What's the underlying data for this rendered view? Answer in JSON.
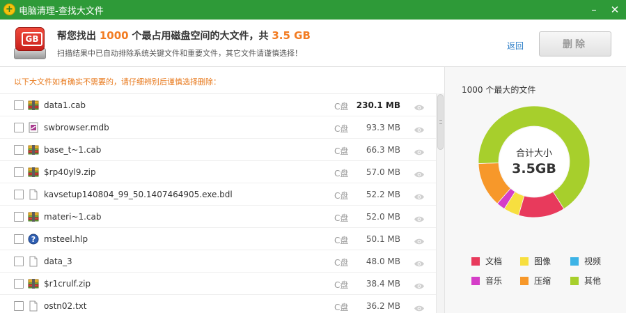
{
  "titlebar": {
    "title": "电脑清理-查找大文件",
    "minimize_glyph": "–",
    "close_glyph": "✕"
  },
  "header": {
    "headline_pre": "帮您找出 ",
    "file_count": "1000",
    "headline_mid": " 个最占用磁盘空间的大文件，共 ",
    "total_size": "3.5 GB",
    "subline": "扫描结果中已自动排除系统关键文件和重要文件，其它文件请谨慎选择！",
    "icon_text": "GB",
    "back_label": "返回",
    "delete_label": "删除"
  },
  "notice": "以下大文件如有确实不需要的，请仔细辨别后谨慎选择删除：",
  "files": [
    {
      "name": "data1.cab",
      "drive": "C盘",
      "size": "230.1 MB",
      "icon": "archive-icon"
    },
    {
      "name": "swbrowser.mdb",
      "drive": "C盘",
      "size": "93.3 MB",
      "icon": "database-file-icon"
    },
    {
      "name": "base_t~1.cab",
      "drive": "C盘",
      "size": "66.3 MB",
      "icon": "archive-icon"
    },
    {
      "name": "$rp40yl9.zip",
      "drive": "C盘",
      "size": "57.0 MB",
      "icon": "archive-icon"
    },
    {
      "name": "kavsetup140804_99_50.1407464905.exe.bdl",
      "drive": "C盘",
      "size": "52.2 MB",
      "icon": "blank-file-icon"
    },
    {
      "name": "materi~1.cab",
      "drive": "C盘",
      "size": "52.0 MB",
      "icon": "archive-icon"
    },
    {
      "name": "msteel.hlp",
      "drive": "C盘",
      "size": "50.1 MB",
      "icon": "help-file-icon"
    },
    {
      "name": "data_3",
      "drive": "C盘",
      "size": "48.0 MB",
      "icon": "blank-file-icon"
    },
    {
      "name": "$r1crulf.zip",
      "drive": "C盘",
      "size": "38.4 MB",
      "icon": "archive-icon"
    },
    {
      "name": "ostn02.txt",
      "drive": "C盘",
      "size": "36.2 MB",
      "icon": "blank-file-icon"
    }
  ],
  "panel": {
    "title": "1000 个最大的文件",
    "donut_label": "合计大小",
    "donut_value": "3.5GB"
  },
  "chart_data": {
    "type": "pie",
    "segments": [
      {
        "name": "文档",
        "color": "#e83a5c",
        "fraction": 0.135
      },
      {
        "name": "图像",
        "color": "#f7df3f",
        "fraction": 0.045
      },
      {
        "name": "音乐",
        "color": "#d53ec8",
        "fraction": 0.025
      },
      {
        "name": "压缩",
        "color": "#f7982a",
        "fraction": 0.13
      },
      {
        "name": "视频",
        "color": "#3db3e6",
        "fraction": 0.0
      },
      {
        "name": "其他",
        "color": "#a7cf2c",
        "fraction": 0.665
      }
    ]
  },
  "legend": [
    {
      "name": "文档",
      "color": "#e83a5c"
    },
    {
      "name": "图像",
      "color": "#f7df3f"
    },
    {
      "name": "视频",
      "color": "#3db3e6"
    },
    {
      "name": "音乐",
      "color": "#d53ec8"
    },
    {
      "name": "压缩",
      "color": "#f7982a"
    },
    {
      "name": "其他",
      "color": "#a7cf2c"
    }
  ]
}
